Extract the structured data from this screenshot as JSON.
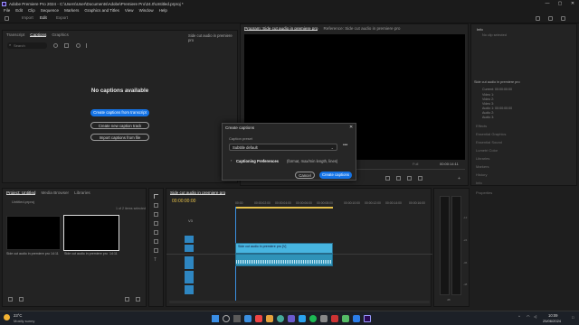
{
  "window": {
    "title": "Adobe Premiere Pro 2024 - C:\\Users\\User\\Documents\\Adobe\\Premiere Pro\\24.0\\Untitled.prproj *",
    "controls": [
      "—",
      "▢",
      "✕"
    ]
  },
  "menu": [
    "File",
    "Edit",
    "Clip",
    "Sequence",
    "Markers",
    "Graphics and Titles",
    "View",
    "Window",
    "Help"
  ],
  "workspace_tabs": [
    "Import",
    "Edit",
    "Export"
  ],
  "left_panel": {
    "tabs": [
      "Transcript",
      "Captions",
      "Graphics"
    ],
    "panel_label": "Side cut audio in premiere pro",
    "search_placeholder": "Search",
    "empty_title": "No captions available",
    "btn_transcript": "Create captions from transcript",
    "btn_new_track": "Create new caption track",
    "btn_import": "Import captions from file"
  },
  "program_monitor": {
    "tabs": [
      "Program: Side cut audio in premiere pro",
      "Reference: Side cut audio in premiere pro"
    ],
    "timecode_left": "00:00:00:00",
    "timecode_right": "00:00:14:11",
    "fit": "Fit",
    "quality": "Full"
  },
  "right_panel": {
    "top_title": "Info",
    "top_sub": "No clip selected",
    "seq_title": "Side cut audio in premiere pro",
    "rows": [
      "Current: 00:00:00:00",
      "Video 1:",
      "Video 2:",
      "Video 3:",
      "Audio 1: 00:00:00:00",
      "Audio 2:",
      "Audio 3:"
    ],
    "sections": [
      "Effects",
      "Essential Graphics",
      "Essential Sound",
      "Lumetri Color",
      "Libraries",
      "Markers",
      "History",
      "Info",
      "Properties"
    ]
  },
  "project_panel": {
    "tabs": [
      "Project: Untitled",
      "Media Browser",
      "Libraries"
    ],
    "project_name": "Untitled.prproj",
    "item_count": "1 of 2 items selected",
    "items": [
      {
        "name": "Side cut audio in premiere pro...",
        "duration": "14:11"
      },
      {
        "name": "Side cut audio in premiere pro",
        "duration": "14:11"
      }
    ]
  },
  "timeline": {
    "tab": "Side cut audio in premiere pro",
    "timecode": "00:00:00:00",
    "ruler": [
      "00:00",
      "00:00:02:00",
      "00:00:04:00",
      "00:00:06:00",
      "00:00:08:00",
      "00:00:10:00",
      "00:00:12:00",
      "00:00:14:00",
      "00:00:16:00"
    ],
    "video_tracks": [
      "V3",
      "V2",
      "V1"
    ],
    "audio_tracks": [
      "A1",
      "A2",
      "A3"
    ],
    "video_clip": "Side cut audio in premiere pro [V]",
    "db_labels": [
      "-12",
      "-24",
      "-36",
      "-48",
      "dB"
    ]
  },
  "dialog": {
    "title": "Create captions",
    "close": "✕",
    "preset_label": "Caption preset",
    "preset_value": "Subtitle default",
    "more": "•••",
    "pref_title": "Captioning Preferences",
    "pref_detail": "(format, max/min length, lines)",
    "cancel": "Cancel",
    "create": "Create captions"
  },
  "taskbar": {
    "weather_temp": "23°C",
    "weather_desc": "Mostly sunny",
    "search_placeholder": "Search",
    "time": "10:09",
    "date": "25/06/2024"
  },
  "colors": {
    "accent": "#1473e6",
    "clip_video": "#47b5e0",
    "clip_audio": "#2f93b8",
    "track_label": "#2e86c1",
    "playhead": "#3b8fe0"
  }
}
